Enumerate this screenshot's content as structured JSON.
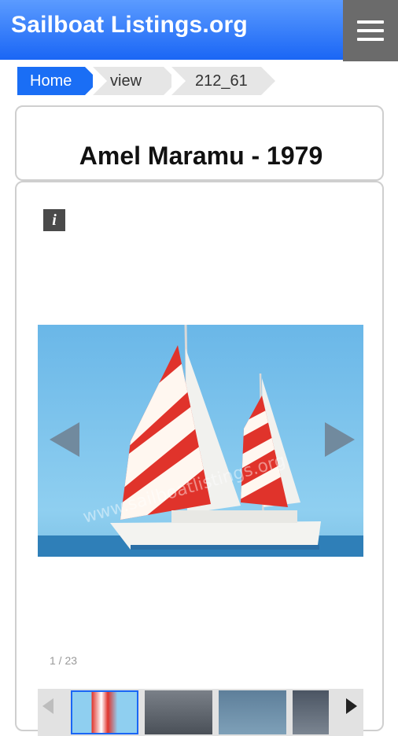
{
  "header": {
    "site_title": "Sailboat Listings.org",
    "menu_icon": "hamburger-menu-icon",
    "brand_color": "#1a66f5"
  },
  "breadcrumb": {
    "items": [
      {
        "label": "Home"
      },
      {
        "label": "view"
      },
      {
        "label": "212_61"
      }
    ]
  },
  "listing": {
    "title": "Amel Maramu - 1979"
  },
  "gallery": {
    "info_label": "i",
    "counter": "1 / 23",
    "watermark": "www.sailboatlistings.org",
    "prev_icon": "left-arrow-icon",
    "next_icon": "right-arrow-icon"
  }
}
